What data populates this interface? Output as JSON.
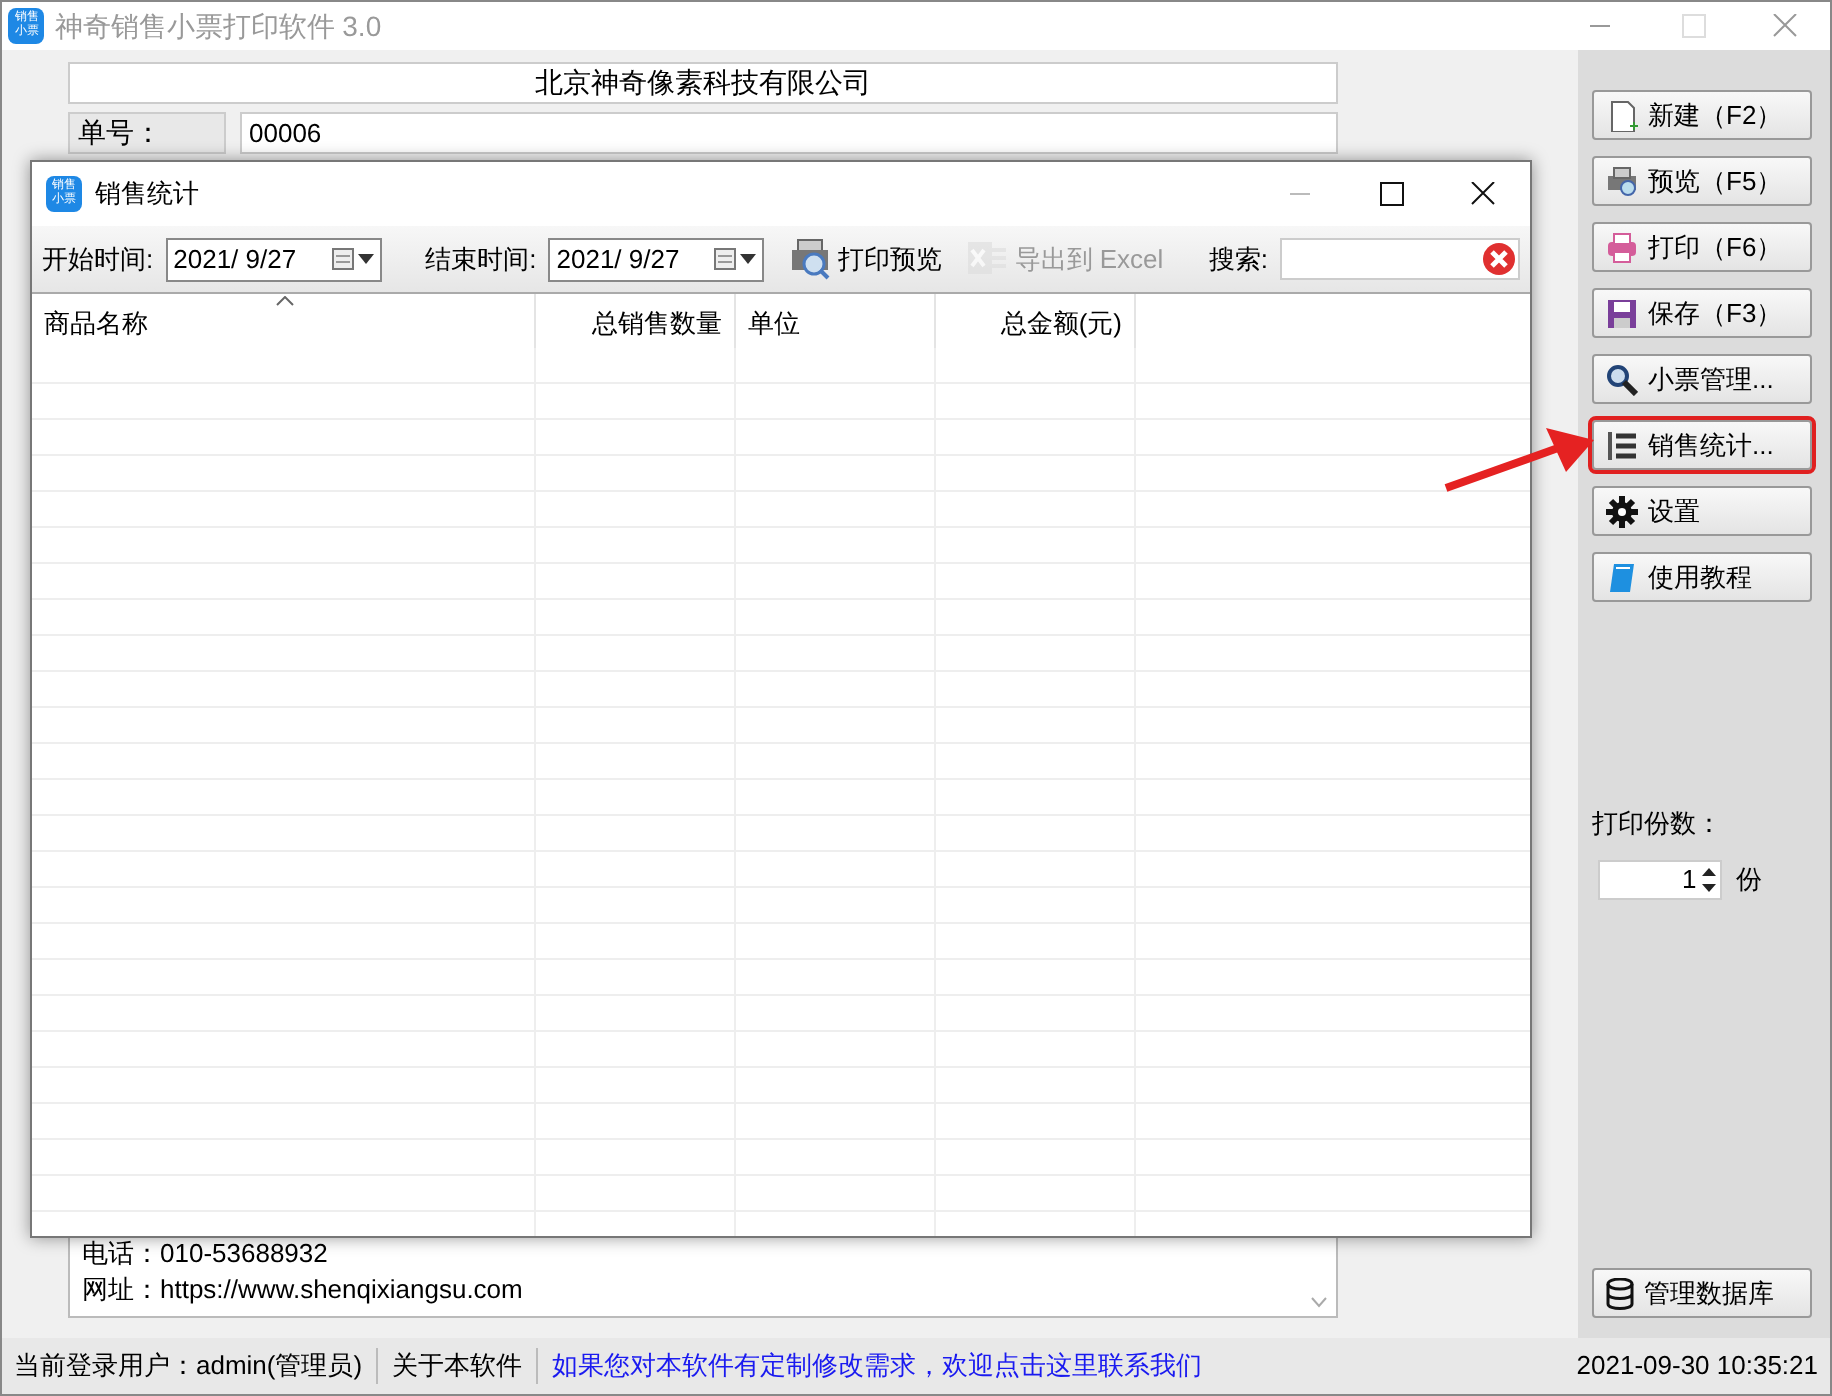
{
  "window": {
    "title": "神奇销售小票打印软件 3.0",
    "app_icon": "销售小票"
  },
  "main_form": {
    "company": "北京神奇像素科技有限公司",
    "fields": [
      {
        "label": "单号：",
        "value": "00006"
      }
    ],
    "footer_lines": [
      "电话：010-53688932",
      "网址：https://www.shenqixiangsu.com"
    ]
  },
  "sidebar": {
    "buttons": [
      {
        "label": "新建（F2）",
        "highlighted": false
      },
      {
        "label": "预览（F5）",
        "highlighted": false
      },
      {
        "label": "打印（F6）",
        "highlighted": false
      },
      {
        "label": "保存（F3）",
        "highlighted": false
      },
      {
        "label": "小票管理...",
        "highlighted": false
      },
      {
        "label": "销售统计...",
        "highlighted": true
      },
      {
        "label": "设置",
        "highlighted": false
      },
      {
        "label": "使用教程",
        "highlighted": false
      }
    ],
    "copies_label": "打印份数：",
    "copies_value": "1",
    "copies_unit": "份",
    "db_button": "管理数据库"
  },
  "dialog": {
    "app_icon": "销售小票",
    "title": "销售统计",
    "start_label": "开始时间:",
    "start_date": "2021/  9/27",
    "end_label": "结束时间:",
    "end_date": "2021/  9/27",
    "tools": [
      {
        "label": "打印预览",
        "disabled": false
      },
      {
        "label": "导出到 Excel",
        "disabled": true
      }
    ],
    "search_label": "搜索:",
    "columns": [
      {
        "label": "商品名称",
        "kind": "text",
        "sorted": true
      },
      {
        "label": "总销售数量",
        "kind": "number",
        "sorted": false
      },
      {
        "label": "单位",
        "kind": "text",
        "sorted": false
      },
      {
        "label": "总金额(元)",
        "kind": "number",
        "sorted": false
      }
    ]
  },
  "status_bar": {
    "user": "当前登录用户：admin(管理员)",
    "about": "关于本软件",
    "link": "如果您对本软件有定制修改需求，欢迎点击这里联系我们",
    "time": "2021-09-30 10:35:21"
  }
}
